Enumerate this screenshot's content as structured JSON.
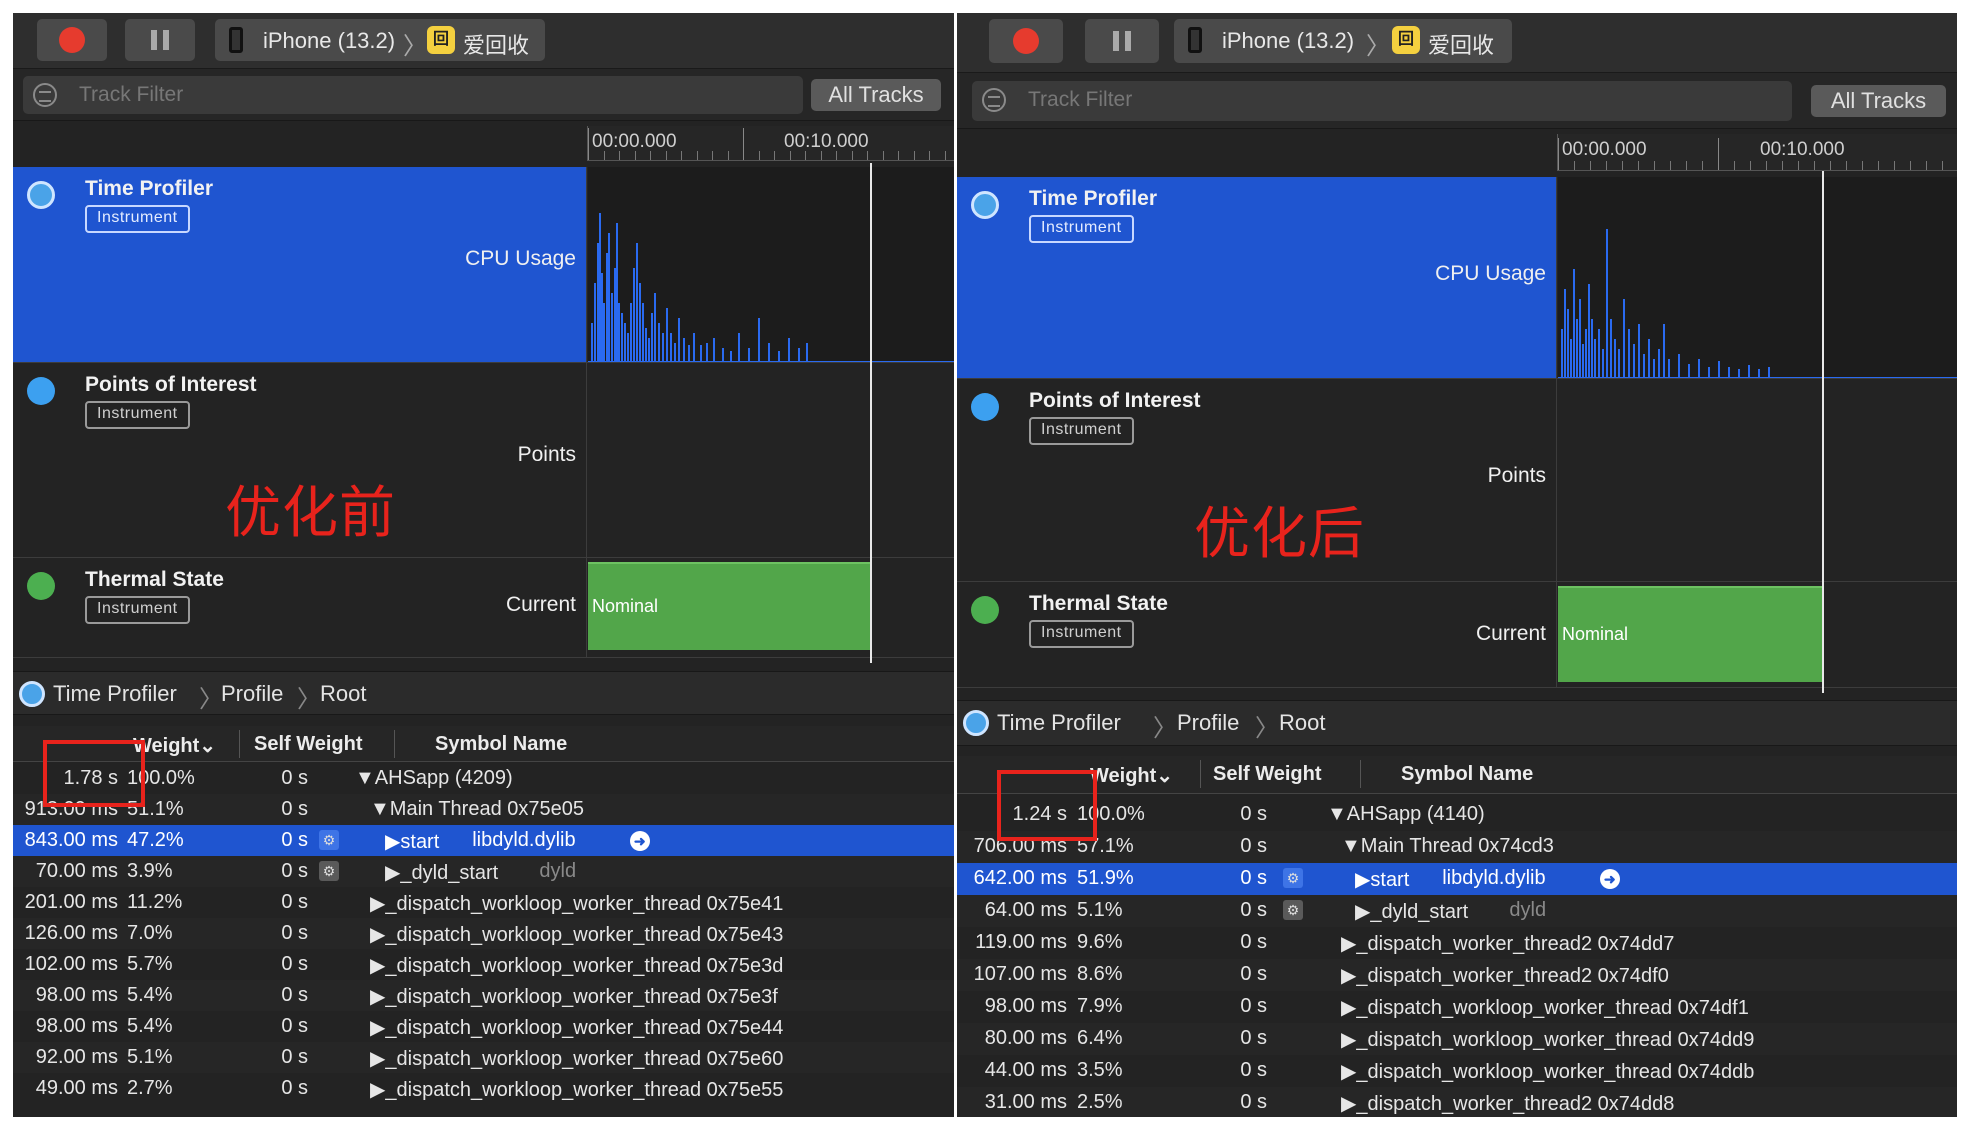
{
  "left": {
    "toolbar": {
      "device": "iPhone (13.2)",
      "app_icon_text": "回",
      "app_name": "爱回收"
    },
    "filter": {
      "placeholder": "Track Filter",
      "all_tracks": "All Tracks"
    },
    "ruler": {
      "t0": "00:00.000",
      "t1": "00:10.000"
    },
    "tracks": [
      {
        "name": "Time Profiler",
        "badge": "Instrument",
        "sub": "CPU Usage"
      },
      {
        "name": "Points of Interest",
        "badge": "Instrument",
        "sub": "Points"
      },
      {
        "name": "Thermal State",
        "badge": "Instrument",
        "sub": "Current",
        "state": "Nominal"
      }
    ],
    "caption": "优化前",
    "breadcrumb": [
      "Time Profiler",
      "Profile",
      "Root"
    ],
    "columns": {
      "weight": "Weight⌄",
      "self": "Self Weight",
      "symbol": "Symbol Name"
    },
    "rows": [
      {
        "w": "1.78 s",
        "p": "100.0%",
        "s": "0 s",
        "sym": "▼AHSapp (4209)",
        "lib": "",
        "lvl": 0
      },
      {
        "w": "913.00 ms",
        "p": "51.1%",
        "s": "0 s",
        "sym": "▼Main Thread  0x75e05",
        "lib": "",
        "lvl": 1
      },
      {
        "w": "843.00 ms",
        "p": "47.2%",
        "s": "0 s",
        "sym": "▶start",
        "lib": "libdyld.dylib",
        "lvl": 2,
        "gear": true,
        "go": true,
        "hl": true
      },
      {
        "w": "70.00 ms",
        "p": "3.9%",
        "s": "0 s",
        "sym": "▶_dyld_start",
        "lib": "dyld",
        "lvl": 2,
        "gear": true
      },
      {
        "w": "201.00 ms",
        "p": "11.2%",
        "s": "0 s",
        "sym": "▶_dispatch_workloop_worker_thread  0x75e41",
        "lib": "",
        "lvl": 1
      },
      {
        "w": "126.00 ms",
        "p": "7.0%",
        "s": "0 s",
        "sym": "▶_dispatch_workloop_worker_thread  0x75e43",
        "lib": "",
        "lvl": 1
      },
      {
        "w": "102.00 ms",
        "p": "5.7%",
        "s": "0 s",
        "sym": "▶_dispatch_workloop_worker_thread  0x75e3d",
        "lib": "",
        "lvl": 1
      },
      {
        "w": "98.00 ms",
        "p": "5.4%",
        "s": "0 s",
        "sym": "▶_dispatch_workloop_worker_thread  0x75e3f",
        "lib": "",
        "lvl": 1
      },
      {
        "w": "98.00 ms",
        "p": "5.4%",
        "s": "0 s",
        "sym": "▶_dispatch_workloop_worker_thread  0x75e44",
        "lib": "",
        "lvl": 1
      },
      {
        "w": "92.00 ms",
        "p": "5.1%",
        "s": "0 s",
        "sym": "▶_dispatch_workloop_worker_thread  0x75e60",
        "lib": "",
        "lvl": 1
      },
      {
        "w": "49.00 ms",
        "p": "2.7%",
        "s": "0 s",
        "sym": "▶_dispatch_workloop_worker_thread  0x75e55",
        "lib": "",
        "lvl": 1
      }
    ]
  },
  "right": {
    "toolbar": {
      "device": "iPhone (13.2)",
      "app_icon_text": "回",
      "app_name": "爱回收"
    },
    "filter": {
      "placeholder": "Track Filter",
      "all_tracks": "All Tracks"
    },
    "ruler": {
      "t0": "00:00.000",
      "t1": "00:10.000"
    },
    "tracks": [
      {
        "name": "Time Profiler",
        "badge": "Instrument",
        "sub": "CPU Usage"
      },
      {
        "name": "Points of Interest",
        "badge": "Instrument",
        "sub": "Points"
      },
      {
        "name": "Thermal State",
        "badge": "Instrument",
        "sub": "Current",
        "state": "Nominal"
      }
    ],
    "caption": "优化后",
    "breadcrumb": [
      "Time Profiler",
      "Profile",
      "Root"
    ],
    "columns": {
      "weight": "Weight⌄",
      "self": "Self Weight",
      "symbol": "Symbol Name"
    },
    "rows": [
      {
        "w": "1.24 s",
        "p": "100.0%",
        "s": "0 s",
        "sym": "▼AHSapp (4140)",
        "lib": "",
        "lvl": 0
      },
      {
        "w": "706.00 ms",
        "p": "57.1%",
        "s": "0 s",
        "sym": "▼Main Thread  0x74cd3",
        "lib": "",
        "lvl": 1
      },
      {
        "w": "642.00 ms",
        "p": "51.9%",
        "s": "0 s",
        "sym": "▶start",
        "lib": "libdyld.dylib",
        "lvl": 2,
        "gear": true,
        "go": true,
        "hl": true
      },
      {
        "w": "64.00 ms",
        "p": "5.1%",
        "s": "0 s",
        "sym": "▶_dyld_start",
        "lib": "dyld",
        "lvl": 2,
        "gear": true
      },
      {
        "w": "119.00 ms",
        "p": "9.6%",
        "s": "0 s",
        "sym": "▶_dispatch_worker_thread2  0x74dd7",
        "lib": "",
        "lvl": 1
      },
      {
        "w": "107.00 ms",
        "p": "8.6%",
        "s": "0 s",
        "sym": "▶_dispatch_worker_thread2  0x74df0",
        "lib": "",
        "lvl": 1
      },
      {
        "w": "98.00 ms",
        "p": "7.9%",
        "s": "0 s",
        "sym": "▶_dispatch_workloop_worker_thread  0x74df1",
        "lib": "",
        "lvl": 1
      },
      {
        "w": "80.00 ms",
        "p": "6.4%",
        "s": "0 s",
        "sym": "▶_dispatch_workloop_worker_thread  0x74dd9",
        "lib": "",
        "lvl": 1
      },
      {
        "w": "44.00 ms",
        "p": "3.5%",
        "s": "0 s",
        "sym": "▶_dispatch_workloop_worker_thread  0x74ddb",
        "lib": "",
        "lvl": 1
      },
      {
        "w": "31.00 ms",
        "p": "2.5%",
        "s": "0 s",
        "sym": "▶_dispatch_worker_thread2  0x74dd8",
        "lib": "",
        "lvl": 1
      }
    ]
  }
}
